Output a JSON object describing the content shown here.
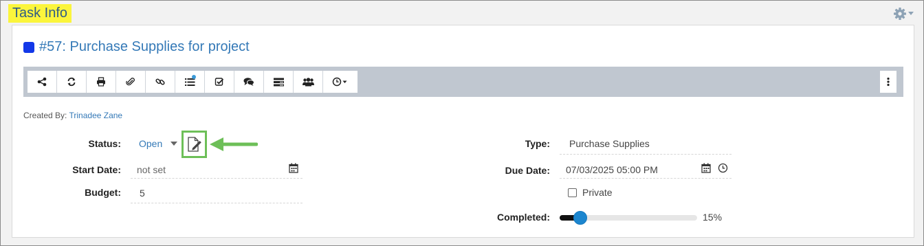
{
  "page": {
    "title": "Task Info"
  },
  "settings": {
    "icon": "gear-icon"
  },
  "task": {
    "color": "#1338e8",
    "title": "#57: Purchase Supplies for project",
    "created_by_label": "Created By:",
    "created_by_name": "Trinadee Zane"
  },
  "toolbar": {
    "buttons": [
      {
        "icon": "share-icon"
      },
      {
        "icon": "refresh-icon"
      },
      {
        "icon": "print-icon"
      },
      {
        "icon": "paperclip-icon"
      },
      {
        "icon": "link-icon"
      },
      {
        "icon": "list-icon",
        "badge": true
      },
      {
        "icon": "checkbox-icon"
      },
      {
        "icon": "comments-icon"
      },
      {
        "icon": "details-icon"
      },
      {
        "icon": "users-icon"
      },
      {
        "icon": "clock-dropdown-icon"
      }
    ],
    "more_icon": "vertical-ellipsis-icon"
  },
  "fields": {
    "status_label": "Status:",
    "status_value": "Open",
    "start_date_label": "Start Date:",
    "start_date_value": "not set",
    "budget_label": "Budget:",
    "budget_value": "5",
    "type_label": "Type:",
    "type_value": "Purchase Supplies",
    "due_date_label": "Due Date:",
    "due_date_value": "07/03/2025 05:00 PM",
    "private_label": "Private",
    "private_checked": false,
    "completed_label": "Completed:",
    "completed_text": "15%",
    "completed_fraction": 0.15
  },
  "colors": {
    "highlight": "#fbf53c",
    "link": "#3479b7",
    "arrow": "#6dbf58",
    "slider_thumb": "#1c86cf"
  }
}
